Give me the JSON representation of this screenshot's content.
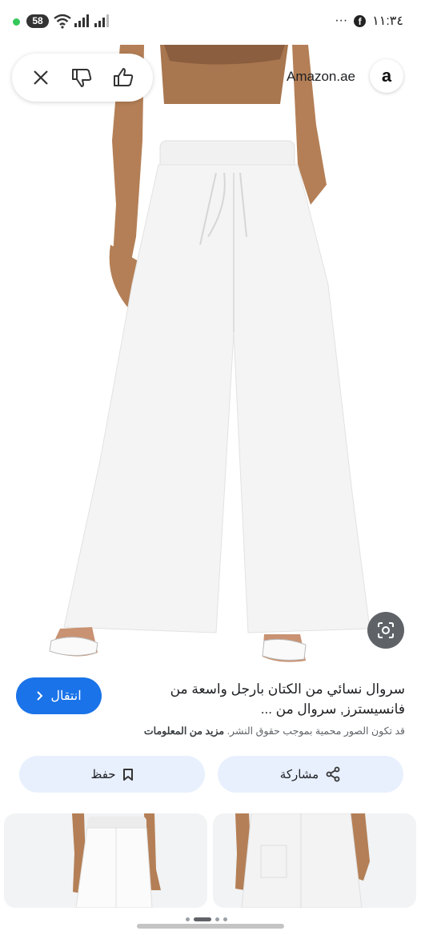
{
  "status_bar": {
    "battery": "58",
    "time": "١١:٣٤",
    "more": "···",
    "facebook": "f"
  },
  "result": {
    "source": "Amazon.ae",
    "amazon_logo_letter": "a",
    "title": "سروال نسائي من الكتان بارجل واسعة من فانسيسترز, سروال من ...",
    "copyright_text": "قد تكون الصور محمية بموجب حقوق النشر.",
    "learn_more": "مزيد من المعلومات",
    "go_button": "انتقال",
    "save_button": "حفظ",
    "share_button": "مشاركة"
  },
  "colors": {
    "accent": "#1a73e8",
    "secondary_button": "#e8f0fe",
    "text": "#202124",
    "muted": "#5f6368"
  },
  "icons": {
    "close": "close-icon",
    "dislike": "thumbs-down-icon",
    "like": "thumbs-up-icon",
    "lens": "lens-icon",
    "bookmark": "bookmark-icon",
    "share": "share-icon",
    "chevron": "chevron-right-icon"
  }
}
